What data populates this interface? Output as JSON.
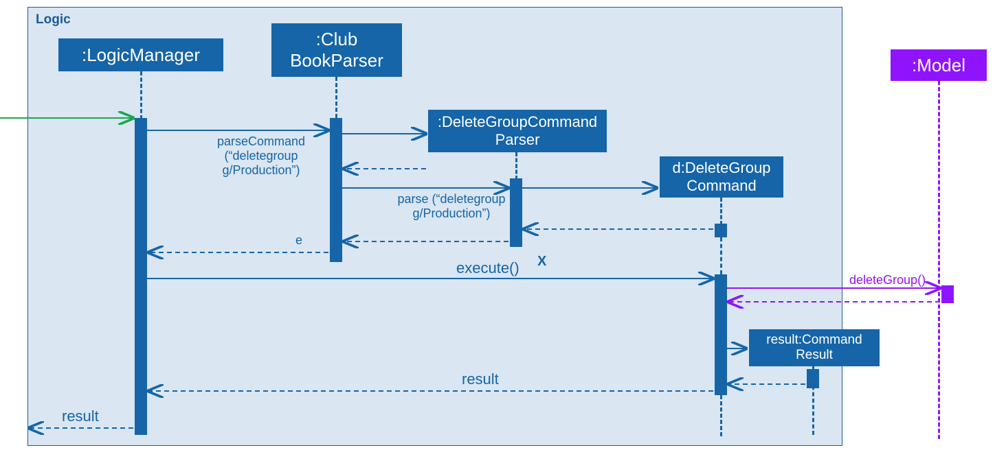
{
  "frame": {
    "label": "Logic"
  },
  "participants": {
    "logicManager": ":LogicManager",
    "clubBookParser": ":Club BookParser",
    "deleteGroupCommandParser": ":DeleteGroupCommand Parser",
    "deleteGroupCommand": "d:DeleteGroup Command",
    "commandResult": "result:Command Result",
    "model": ":Model"
  },
  "messages": {
    "parseCommand": "parseCommand (“deletegroup g/Production”)",
    "parse": "parse (“deletegroup g/Production”)",
    "eReturn": "e",
    "execute": "execute()",
    "deleteGroup": "deleteGroup()",
    "resultReturn": "result",
    "finalResult": "result"
  }
}
